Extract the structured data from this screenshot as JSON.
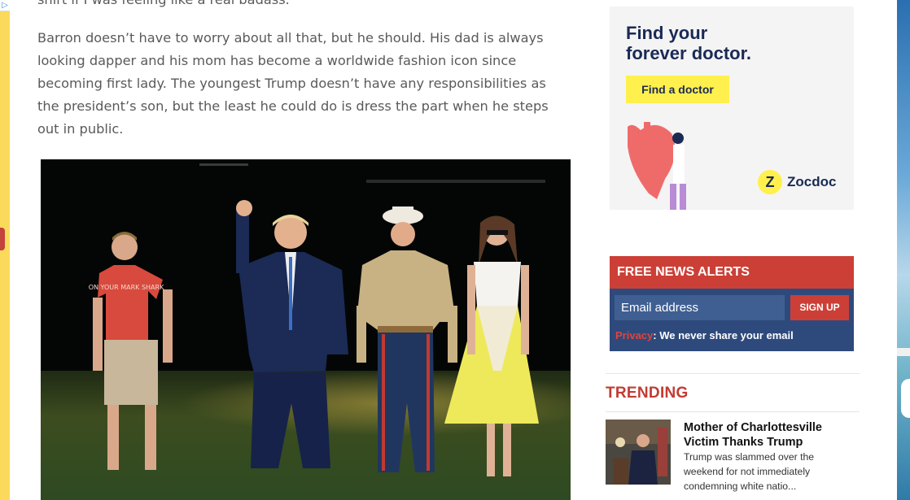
{
  "article": {
    "cut_line": "shirt if I was feeling like a real badass.",
    "paragraph": "Barron doesn’t have to worry about all that, but he should. His dad is always looking dapper and his mom has become a worldwide fashion icon since becoming first lady. The youngest Trump doesn’t have any responsibilities as the president’s son, but the least he could do is dress the part when he steps out in public.",
    "photo_shirt_text": "ON YOUR MARK SHARK"
  },
  "ad": {
    "headline_line1": "Find your",
    "headline_line2": "forever doctor.",
    "button_label": "Find a doctor",
    "logo_text": "Zocdoc",
    "logo_mark": "Z",
    "colors": {
      "background": "#f4f4f4",
      "button": "#fff04d",
      "text": "#1a2a55"
    }
  },
  "alerts": {
    "title": "FREE NEWS ALERTS",
    "email_placeholder": "Email address",
    "signup_label": "SIGN UP",
    "privacy_link": "Privacy",
    "privacy_text": ": We never share your email",
    "colors": {
      "header": "#cc3f36",
      "body": "#2e4a7c"
    }
  },
  "trending": {
    "title": "TRENDING",
    "items": [
      {
        "headline": "Mother of Charlottesville Victim Thanks Trump",
        "description": "Trump was slammed over the weekend for not immediately condemning white natio..."
      }
    ]
  },
  "ad_choices_icon": "ad-choices-icon"
}
